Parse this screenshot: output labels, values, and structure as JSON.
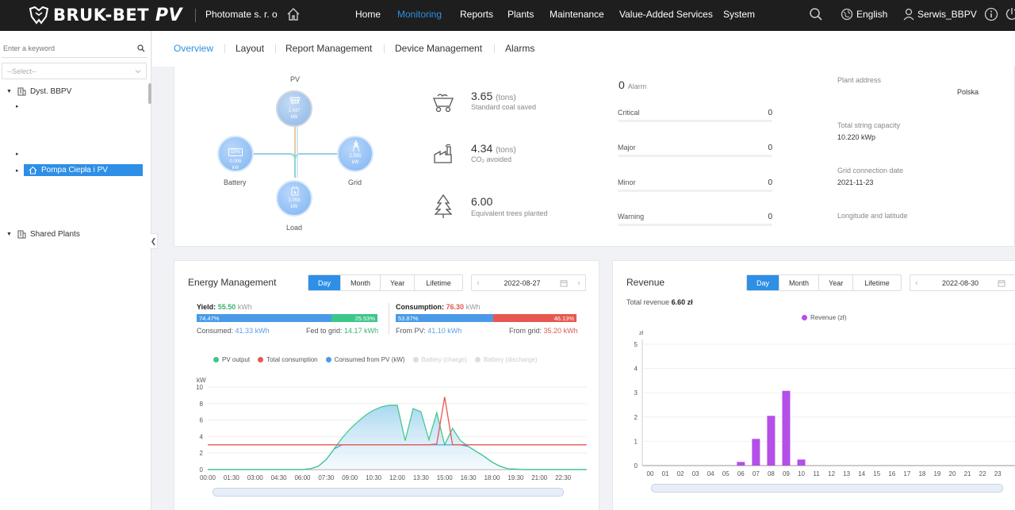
{
  "brand": {
    "name": "BRUK-BET",
    "suffix": "PV"
  },
  "company": "Photomate s. r. o",
  "nav": [
    "Home",
    "Monitoring",
    "Reports",
    "Plants",
    "Maintenance",
    "Value-Added Services",
    "System"
  ],
  "nav_active": "Monitoring",
  "language": "English",
  "user": "Serwis_BBPV",
  "sidebar": {
    "search_placeholder": "Enter a keyword",
    "select_placeholder": "--Select--",
    "tree": [
      {
        "label": "Dyst. BBPV"
      },
      {
        "label": "Pompa Ciepła i PV",
        "selected": true
      },
      {
        "label": "Shared Plants"
      }
    ]
  },
  "tabs": [
    "Overview",
    "Layout",
    "Report Management",
    "Device Management",
    "Alarms"
  ],
  "tabs_active": "Overview",
  "flow": {
    "pv": {
      "label": "PV",
      "value": "1.437",
      "unit": "kW"
    },
    "battery": {
      "label": "Battery",
      "soc": "10%",
      "value": "0.006",
      "unit": "kW"
    },
    "grid": {
      "label": "Grid",
      "value": "1.595",
      "unit": "kW"
    },
    "load": {
      "label": "Load",
      "value": "3.058",
      "unit": "kW"
    }
  },
  "environment": [
    {
      "value": "3.65",
      "unit": "(tons)",
      "label": "Standard coal saved",
      "icon": "coal-cart-icon"
    },
    {
      "value": "4.34",
      "unit": "(tons)",
      "label": "CO₂ avoided",
      "icon": "factory-icon"
    },
    {
      "value": "6.00",
      "unit": "",
      "label": "Equivalent trees planted",
      "icon": "tree-icon"
    }
  ],
  "alarms": {
    "total": "0",
    "total_label": "Alarm",
    "levels": [
      {
        "label": "Critical",
        "count": "0"
      },
      {
        "label": "Major",
        "count": "0"
      },
      {
        "label": "Minor",
        "count": "0"
      },
      {
        "label": "Warning",
        "count": "0"
      }
    ]
  },
  "plant_info": {
    "address_label": "Plant address",
    "address": "Polska",
    "capacity_label": "Total string capacity",
    "capacity": "10.220 kWp",
    "grid_date_label": "Grid connection date",
    "grid_date": "2021-11-23",
    "lonlat_label": "Longitude and latitude"
  },
  "energy": {
    "title": "Energy Management",
    "periods": [
      "Day",
      "Month",
      "Year",
      "Lifetime"
    ],
    "period_active": "Day",
    "date": "2022-08-27",
    "yield_label": "Yield:",
    "yield_value": "55.50",
    "yield_unit": "kWh",
    "yield_bar": {
      "self_pct": "74.47%",
      "grid_pct": "25.53%",
      "self_frac": 0.7447
    },
    "consumed_label": "Consumed:",
    "consumed_value": "41.33",
    "consumed_unit": "kWh",
    "fed_label": "Fed to grid:",
    "fed_value": "14.17",
    "fed_unit": "kWh",
    "consumption_label": "Consumption:",
    "consumption_value": "76.30",
    "consumption_unit": "kWh",
    "consumption_bar": {
      "pv_pct": "53.87%",
      "grid_pct": "46.13%",
      "pv_frac": 0.5387
    },
    "frompv_label": "From PV:",
    "frompv_value": "41.10",
    "frompv_unit": "kWh",
    "fromgrid_label": "From grid:",
    "fromgrid_value": "35.20",
    "fromgrid_unit": "kWh"
  },
  "revenue": {
    "title": "Revenue",
    "periods": [
      "Day",
      "Month",
      "Year",
      "Lifetime"
    ],
    "period_active": "Day",
    "date": "2022-08-30",
    "total_label": "Total revenue",
    "total_value": "6.60 zł"
  },
  "colors": {
    "accent": "#2e8fe6",
    "pv": "#3cc68a",
    "consumption": "#e8574f",
    "from_pv": "#4a9ae8",
    "revenue": "#b44fe8"
  },
  "chart_data": [
    {
      "type": "line",
      "ylabel": "kW",
      "ylim": [
        0,
        10
      ],
      "yticks": [
        0,
        2,
        4,
        6,
        8,
        10
      ],
      "xticks": [
        "00:00",
        "01:30",
        "03:00",
        "04:30",
        "06:00",
        "07:30",
        "09:00",
        "10:30",
        "12:00",
        "13:30",
        "15:00",
        "16:30",
        "18:00",
        "19:30",
        "21:00",
        "22:30"
      ],
      "x": [
        "00:00",
        "05:00",
        "06:00",
        "06:30",
        "07:00",
        "07:30",
        "08:00",
        "08:30",
        "09:00",
        "09:30",
        "10:00",
        "10:30",
        "11:00",
        "11:30",
        "12:00",
        "12:30",
        "13:00",
        "13:30",
        "14:00",
        "14:30",
        "15:00",
        "15:30",
        "16:00",
        "16:30",
        "17:00",
        "17:30",
        "18:00",
        "18:30",
        "19:00",
        "20:00",
        "23:59"
      ],
      "series": [
        {
          "name": "PV output",
          "color": "#3cc68a",
          "values": [
            0,
            0,
            0,
            0.1,
            0.4,
            1.2,
            2.5,
            3.8,
            4.9,
            5.8,
            6.6,
            7.2,
            7.6,
            7.8,
            7.8,
            3.5,
            7.4,
            7.0,
            3.6,
            6.9,
            3.0,
            5.0,
            3.5,
            2.8,
            2.2,
            1.6,
            0.9,
            0.4,
            0.1,
            0,
            0
          ]
        },
        {
          "name": "Total consumption",
          "color": "#e8574f",
          "values": [
            3.0,
            3.0,
            3.0,
            3.0,
            3.0,
            3.0,
            3.0,
            3.0,
            3.0,
            3.0,
            3.0,
            3.0,
            3.0,
            3.0,
            3.0,
            3.0,
            3.0,
            3.0,
            3.0,
            3.1,
            8.8,
            3.0,
            3.0,
            3.0,
            3.0,
            3.0,
            3.0,
            3.0,
            3.0,
            3.0,
            3.0
          ]
        },
        {
          "name": "Consumed from PV (kW)",
          "color": "#4a9ae8",
          "values": [
            0,
            0,
            0,
            0.1,
            0.4,
            1.2,
            2.5,
            3.0,
            3.0,
            3.0,
            3.0,
            3.0,
            3.0,
            3.0,
            3.0,
            3.0,
            3.0,
            3.0,
            3.0,
            3.0,
            3.0,
            3.0,
            3.0,
            2.8,
            2.2,
            1.6,
            0.9,
            0.4,
            0.1,
            0,
            0
          ]
        },
        {
          "name": "Battery (charge)",
          "color": "#cccccc",
          "values": [],
          "disabled": true
        },
        {
          "name": "Battery (discharge)",
          "color": "#cccccc",
          "values": [],
          "disabled": true
        }
      ]
    },
    {
      "type": "bar",
      "ylabel": "zł",
      "ylim": [
        0,
        5
      ],
      "yticks": [
        0,
        1,
        2,
        3,
        4,
        5
      ],
      "categories": [
        "00",
        "01",
        "02",
        "03",
        "04",
        "05",
        "06",
        "07",
        "08",
        "09",
        "10",
        "11",
        "12",
        "13",
        "14",
        "15",
        "16",
        "17",
        "18",
        "19",
        "20",
        "21",
        "22",
        "23"
      ],
      "series": [
        {
          "name": "Revenue (zł)",
          "color": "#b44fe8",
          "values": [
            0,
            0,
            0,
            0,
            0,
            0,
            0.15,
            1.1,
            2.05,
            3.08,
            0.25,
            0,
            0,
            0,
            0,
            0,
            0,
            0,
            0,
            0,
            0,
            0,
            0,
            0
          ]
        }
      ]
    }
  ]
}
